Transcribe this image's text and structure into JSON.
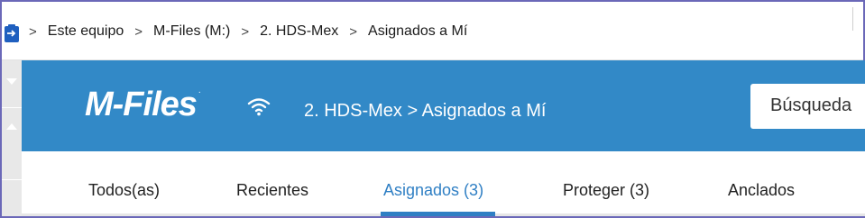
{
  "breadcrumb": {
    "items": [
      "Este equipo",
      "M-Files (M:)",
      "2. HDS-Mex",
      "Asignados a Mí"
    ],
    "separator": ">"
  },
  "header": {
    "logo_text": "M-Files",
    "logo_reg": ".",
    "path": "2. HDS-Mex > Asignados a Mí",
    "search_label": "Búsqueda",
    "background_color": "#3289c7"
  },
  "tabs": [
    {
      "label": "Todos(as)",
      "active": false
    },
    {
      "label": "Recientes",
      "active": false
    },
    {
      "label": "Asignados (3)",
      "active": true
    },
    {
      "label": "Proteger (3)",
      "active": false
    },
    {
      "label": "Anclados",
      "active": false
    }
  ],
  "icons": {
    "app": "clipboard-arrow-icon",
    "status": "wifi-icon"
  },
  "colors": {
    "accent": "#2f7fc4",
    "frame": "#6b68b8"
  }
}
